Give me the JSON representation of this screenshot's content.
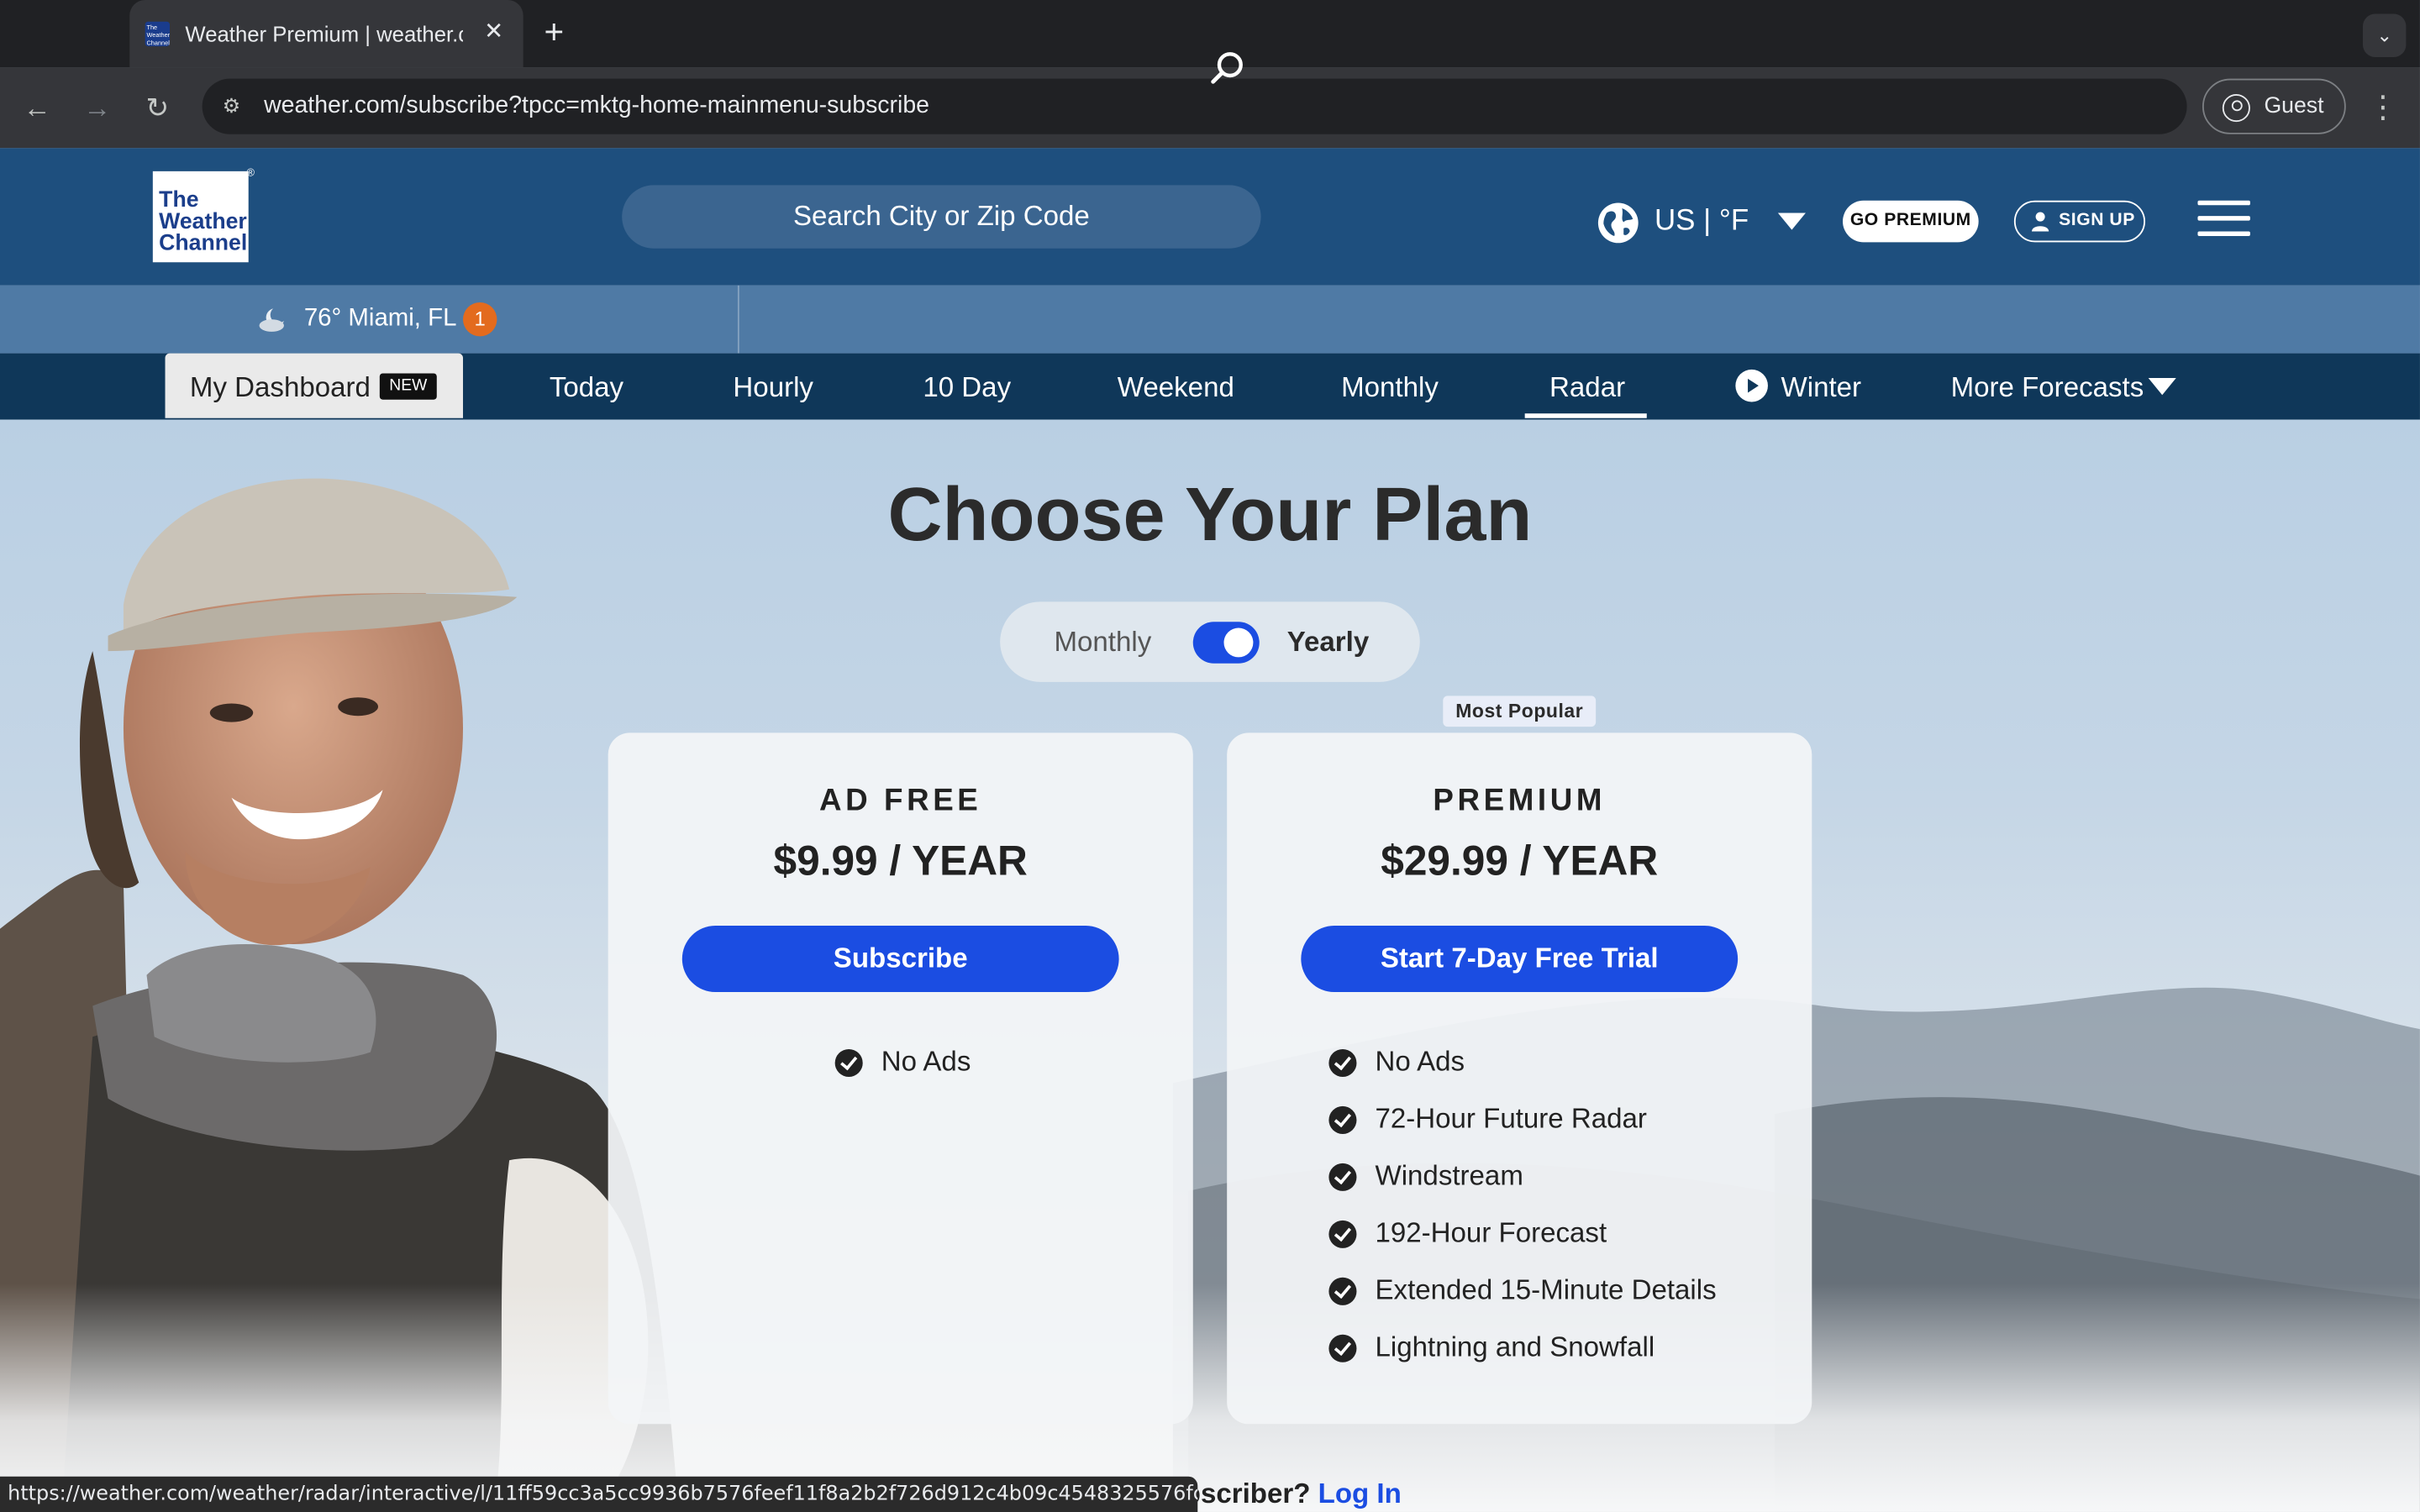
{
  "browser": {
    "tab_title": "Weather Premium | weather.c",
    "tab_favicon_text": "The Weather Channel",
    "url": "weather.com/subscribe?tpcc=mktg-home-mainmenu-subscribe",
    "profile_label": "Guest",
    "status_url": "https://weather.com/weather/radar/interactive/l/11ff59cc3a5cc9936b7576feef11f8a2b2f726d912c4b09c4548325576fc0fe3"
  },
  "header": {
    "logo": [
      "The",
      "Weather",
      "Channel"
    ],
    "search_placeholder": "Search City or Zip Code",
    "units": "US | °F",
    "go_premium": "GO PREMIUM",
    "sign_up": "SIGN UP"
  },
  "location": {
    "text": "76° Miami, FL",
    "alert_count": "1"
  },
  "nav": {
    "dashboard": "My Dashboard",
    "dashboard_badge": "NEW",
    "items": [
      "Today",
      "Hourly",
      "10 Day",
      "Weekend",
      "Monthly",
      "Radar",
      "Winter",
      "More Forecasts"
    ],
    "active": "Radar"
  },
  "plans": {
    "title": "Choose Your Plan",
    "toggle": {
      "left": "Monthly",
      "right": "Yearly",
      "selected": "Yearly"
    },
    "badge": "Most Popular",
    "cards": [
      {
        "name": "AD FREE",
        "price": "$9.99 / YEAR",
        "button": "Subscribe",
        "features": [
          "No Ads"
        ]
      },
      {
        "name": "PREMIUM",
        "price": "$29.99 / YEAR",
        "button": "Start 7-Day Free Trial",
        "features": [
          "No Ads",
          "72-Hour Future Radar",
          "Windstream",
          "192-Hour Forecast",
          "Extended 15-Minute Details",
          "Lightning and Snowfall"
        ]
      }
    ],
    "subscriber_text": "Already a subscriber?",
    "login_link": "Log In"
  },
  "colors": {
    "header_bg": "#1e4f7e",
    "nav_bg": "#0f3759",
    "accent": "#1b4de2",
    "alert_badge": "#e36b1e"
  }
}
